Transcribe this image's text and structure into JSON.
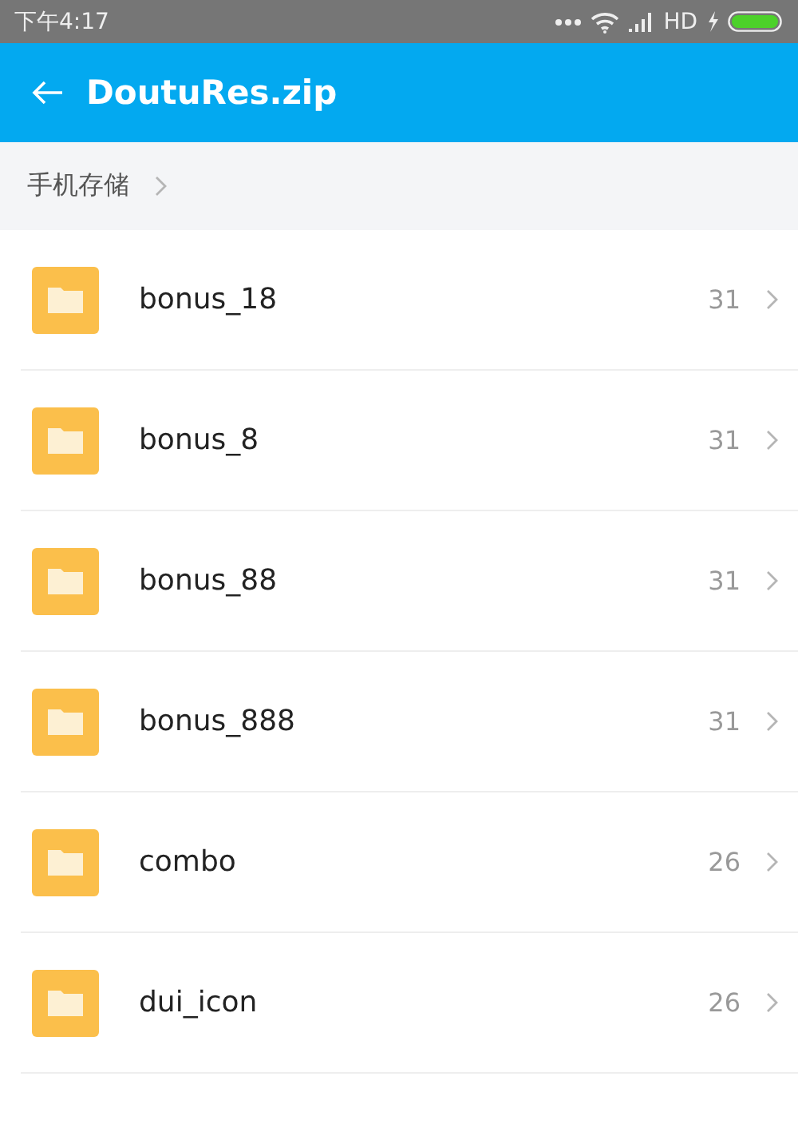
{
  "status_bar": {
    "time": "下午4:17",
    "network": "HD"
  },
  "app_bar": {
    "title": "DoutuRes.zip"
  },
  "breadcrumb": {
    "items": [
      "手机存储"
    ]
  },
  "files": [
    {
      "name": "bonus_18",
      "count": "31"
    },
    {
      "name": "bonus_8",
      "count": "31"
    },
    {
      "name": "bonus_88",
      "count": "31"
    },
    {
      "name": "bonus_888",
      "count": "31"
    },
    {
      "name": "combo",
      "count": "26"
    },
    {
      "name": "dui_icon",
      "count": "26"
    }
  ]
}
